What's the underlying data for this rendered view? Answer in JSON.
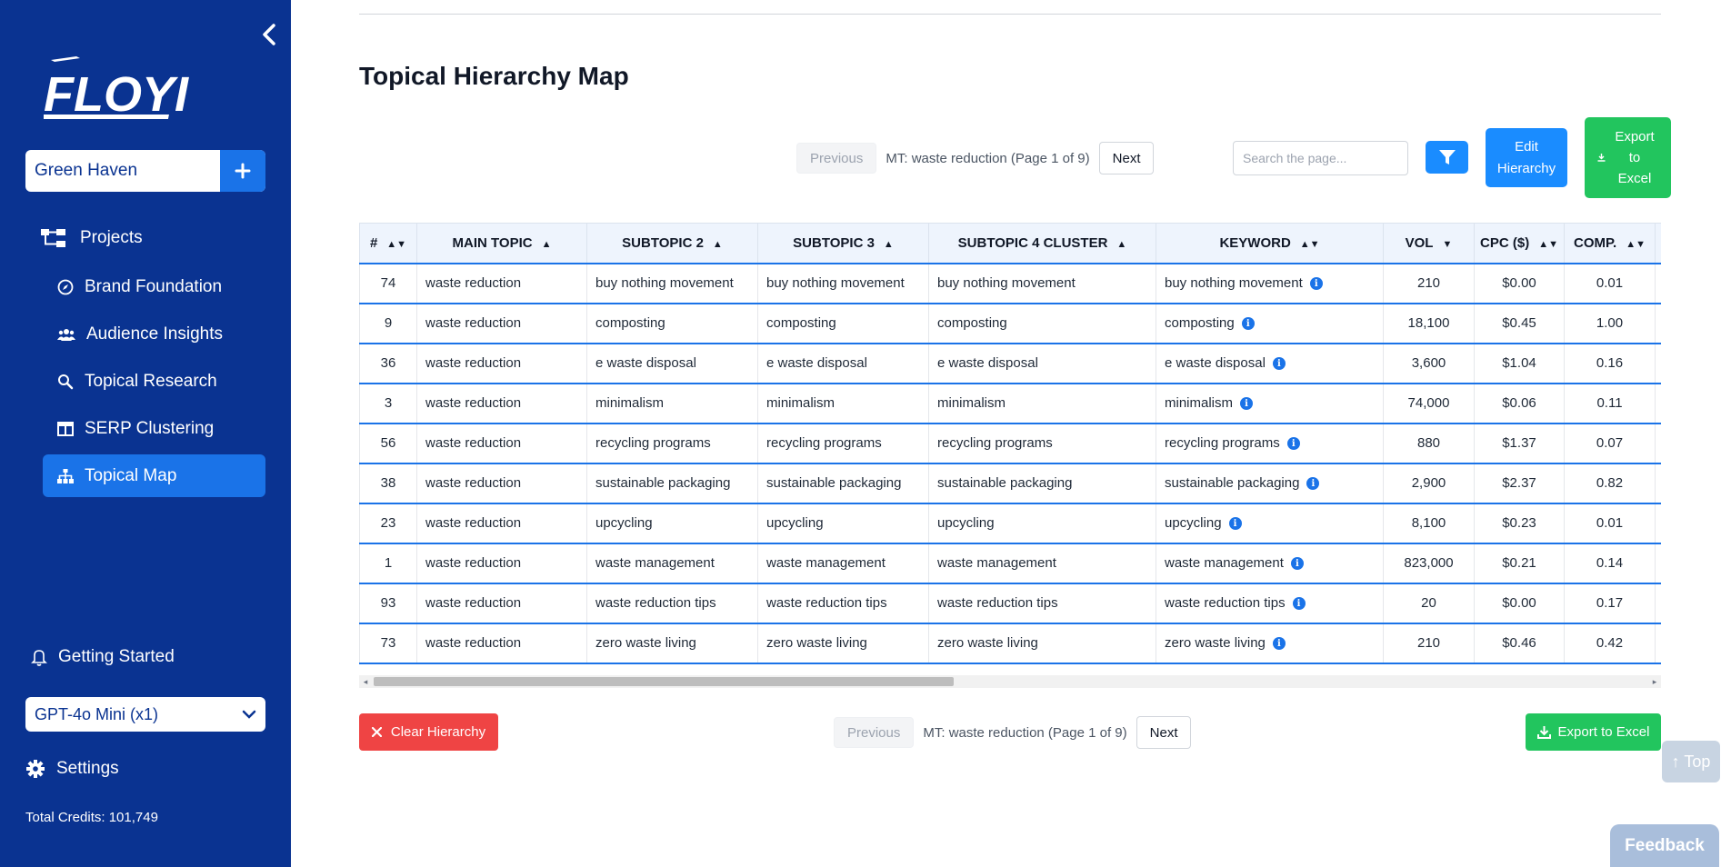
{
  "sidebar": {
    "brand": "FLOYI",
    "project_name": "Green Haven",
    "projects_label": "Projects",
    "items": [
      {
        "label": "Brand Foundation",
        "icon": "compass-icon"
      },
      {
        "label": "Audience Insights",
        "icon": "users-icon"
      },
      {
        "label": "Topical Research",
        "icon": "magnify-icon"
      },
      {
        "label": "SERP Clustering",
        "icon": "columns-icon"
      },
      {
        "label": "Topical Map",
        "icon": "sitemap-icon",
        "active": true
      }
    ],
    "getting_started": "Getting Started",
    "model": "GPT-4o Mini (x1)",
    "settings": "Settings",
    "credits": "Total Credits: 101,749"
  },
  "main": {
    "title": "Topical Hierarchy Map",
    "pager_top": {
      "previous": "Previous",
      "info": "MT: waste reduction (Page 1 of 9)",
      "next": "Next"
    },
    "search_placeholder": "Search the page...",
    "edit_hierarchy": "Edit Hierarchy",
    "export_excel_top": "Export to Excel",
    "columns": [
      "#",
      "MAIN TOPIC",
      "SUBTOPIC 2",
      "SUBTOPIC 3",
      "SUBTOPIC 4 CLUSTER",
      "KEYWORD",
      "VOL",
      "CPC ($)",
      "COMP."
    ],
    "rows": [
      {
        "num": "74",
        "main": "waste reduction",
        "sub2": "buy nothing movement",
        "sub3": "buy nothing movement",
        "sub4": "buy nothing movement",
        "keyword": "buy nothing movement",
        "vol": "210",
        "cpc": "$0.00",
        "comp": "0.01"
      },
      {
        "num": "9",
        "main": "waste reduction",
        "sub2": "composting",
        "sub3": "composting",
        "sub4": "composting",
        "keyword": "composting",
        "vol": "18,100",
        "cpc": "$0.45",
        "comp": "1.00"
      },
      {
        "num": "36",
        "main": "waste reduction",
        "sub2": "e waste disposal",
        "sub3": "e waste disposal",
        "sub4": "e waste disposal",
        "keyword": "e waste disposal",
        "vol": "3,600",
        "cpc": "$1.04",
        "comp": "0.16"
      },
      {
        "num": "3",
        "main": "waste reduction",
        "sub2": "minimalism",
        "sub3": "minimalism",
        "sub4": "minimalism",
        "keyword": "minimalism",
        "vol": "74,000",
        "cpc": "$0.06",
        "comp": "0.11"
      },
      {
        "num": "56",
        "main": "waste reduction",
        "sub2": "recycling programs",
        "sub3": "recycling programs",
        "sub4": "recycling programs",
        "keyword": "recycling programs",
        "vol": "880",
        "cpc": "$1.37",
        "comp": "0.07"
      },
      {
        "num": "38",
        "main": "waste reduction",
        "sub2": "sustainable packaging",
        "sub3": "sustainable packaging",
        "sub4": "sustainable packaging",
        "keyword": "sustainable packaging",
        "vol": "2,900",
        "cpc": "$2.37",
        "comp": "0.82"
      },
      {
        "num": "23",
        "main": "waste reduction",
        "sub2": "upcycling",
        "sub3": "upcycling",
        "sub4": "upcycling",
        "keyword": "upcycling",
        "vol": "8,100",
        "cpc": "$0.23",
        "comp": "0.01"
      },
      {
        "num": "1",
        "main": "waste reduction",
        "sub2": "waste management",
        "sub3": "waste management",
        "sub4": "waste management",
        "keyword": "waste management",
        "vol": "823,000",
        "cpc": "$0.21",
        "comp": "0.14"
      },
      {
        "num": "93",
        "main": "waste reduction",
        "sub2": "waste reduction tips",
        "sub3": "waste reduction tips",
        "sub4": "waste reduction tips",
        "keyword": "waste reduction tips",
        "vol": "20",
        "cpc": "$0.00",
        "comp": "0.17"
      },
      {
        "num": "73",
        "main": "waste reduction",
        "sub2": "zero waste living",
        "sub3": "zero waste living",
        "sub4": "zero waste living",
        "keyword": "zero waste living",
        "vol": "210",
        "cpc": "$0.46",
        "comp": "0.42"
      }
    ],
    "clear_hierarchy": "Clear Hierarchy",
    "pager_bottom": {
      "previous": "Previous",
      "info": "MT: waste reduction (Page 1 of 9)",
      "next": "Next"
    },
    "export_excel_bottom": "Export to Excel",
    "top_button": "↑ Top",
    "feedback": "Feedback"
  },
  "colors": {
    "sidebar_bg": "#0a3391",
    "accent_blue": "#1a73e8",
    "green": "#22c55e",
    "red": "#ef4444"
  }
}
